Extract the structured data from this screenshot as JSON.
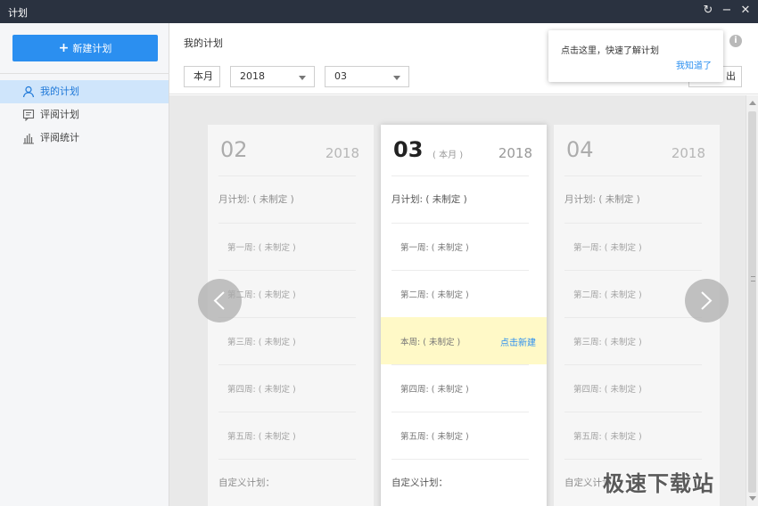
{
  "window": {
    "title": "计划",
    "refresh_glyph": "↻",
    "minimize_glyph": "−",
    "close_glyph": "✕"
  },
  "sidebar": {
    "new_plan_label": "新建计划",
    "items": [
      {
        "label": "我的计划",
        "icon": "user-icon",
        "active": true
      },
      {
        "label": "评阅计划",
        "icon": "review-icon",
        "active": false
      },
      {
        "label": "评阅统计",
        "icon": "bar-chart-icon",
        "active": false
      }
    ]
  },
  "header": {
    "title": "我的计划",
    "this_month_label": "本月",
    "year_value": "2018",
    "month_value": "03",
    "export_label": "出",
    "info_glyph": "i"
  },
  "tooltip": {
    "text": "点击这里，快速了解计划",
    "link": "我知道了"
  },
  "cards": [
    {
      "month": "02",
      "badge": "",
      "year": "2018",
      "month_plan": "月计划: ( 未制定 )",
      "weeks": [
        "第一周: ( 未制定 )",
        "第二周: ( 未制定 )",
        "第三周: ( 未制定 )",
        "第四周: ( 未制定 )",
        "第五周: ( 未制定 )"
      ],
      "custom_plan": "自定义计划："
    },
    {
      "month": "03",
      "badge": "( 本月 )",
      "year": "2018",
      "month_plan": "月计划: ( 未制定 )",
      "weeks": [
        "第一周: ( 未制定 )",
        "第二周: ( 未制定 )",
        "本周: ( 未制定 )",
        "第四周: ( 未制定 )",
        "第五周: ( 未制定 )"
      ],
      "create_link": "点击新建",
      "custom_plan": "自定义计划："
    },
    {
      "month": "04",
      "badge": "",
      "year": "2018",
      "month_plan": "月计划: ( 未制定 )",
      "weeks": [
        "第一周: ( 未制定 )",
        "第二周: ( 未制定 )",
        "第三周: ( 未制定 )",
        "第四周: ( 未制定 )",
        "第五周: ( 未制定 )"
      ],
      "custom_plan": "自定义计划："
    }
  ],
  "watermark": "极速下载站",
  "colors": {
    "accent": "#2b8ff0",
    "titlebar": "#2a3240",
    "highlight": "#fff9c7",
    "active_item": "#cfe5fb"
  }
}
